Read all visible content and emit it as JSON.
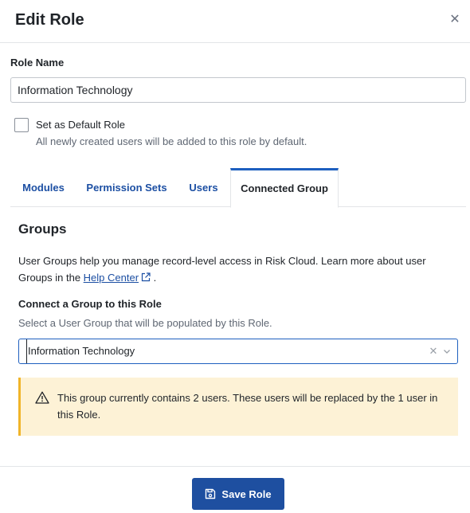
{
  "dialog": {
    "title": "Edit Role",
    "close_icon": "close-icon"
  },
  "role_name": {
    "label": "Role Name",
    "value": "Information Technology"
  },
  "default_role": {
    "label": "Set as Default Role",
    "help": "All newly created users will be added to this role by default.",
    "checked": false
  },
  "tabs": [
    {
      "label": "Modules",
      "active": false
    },
    {
      "label": "Permission Sets",
      "active": false
    },
    {
      "label": "Users",
      "active": false
    },
    {
      "label": "Connected Group",
      "active": true
    }
  ],
  "groups": {
    "title": "Groups",
    "description_prefix": "User Groups help you manage record-level access in Risk Cloud. Learn more about user Groups in the",
    "link_text": "Help Center",
    "description_suffix": ".",
    "connect_label": "Connect a Group to this Role",
    "connect_help": "Select a User Group that will be populated by this Role.",
    "selected_group": "Information Technology"
  },
  "warning": {
    "text": "This group currently contains 2 users. These users will be replaced by the 1 user in this Role.",
    "color": "#f0b429"
  },
  "footer": {
    "save_label": "Save Role",
    "save_icon": "save-icon"
  },
  "colors": {
    "primary": "#1e4fa0",
    "link": "#1c4fa3",
    "warning_bg": "#fdf2d6"
  }
}
